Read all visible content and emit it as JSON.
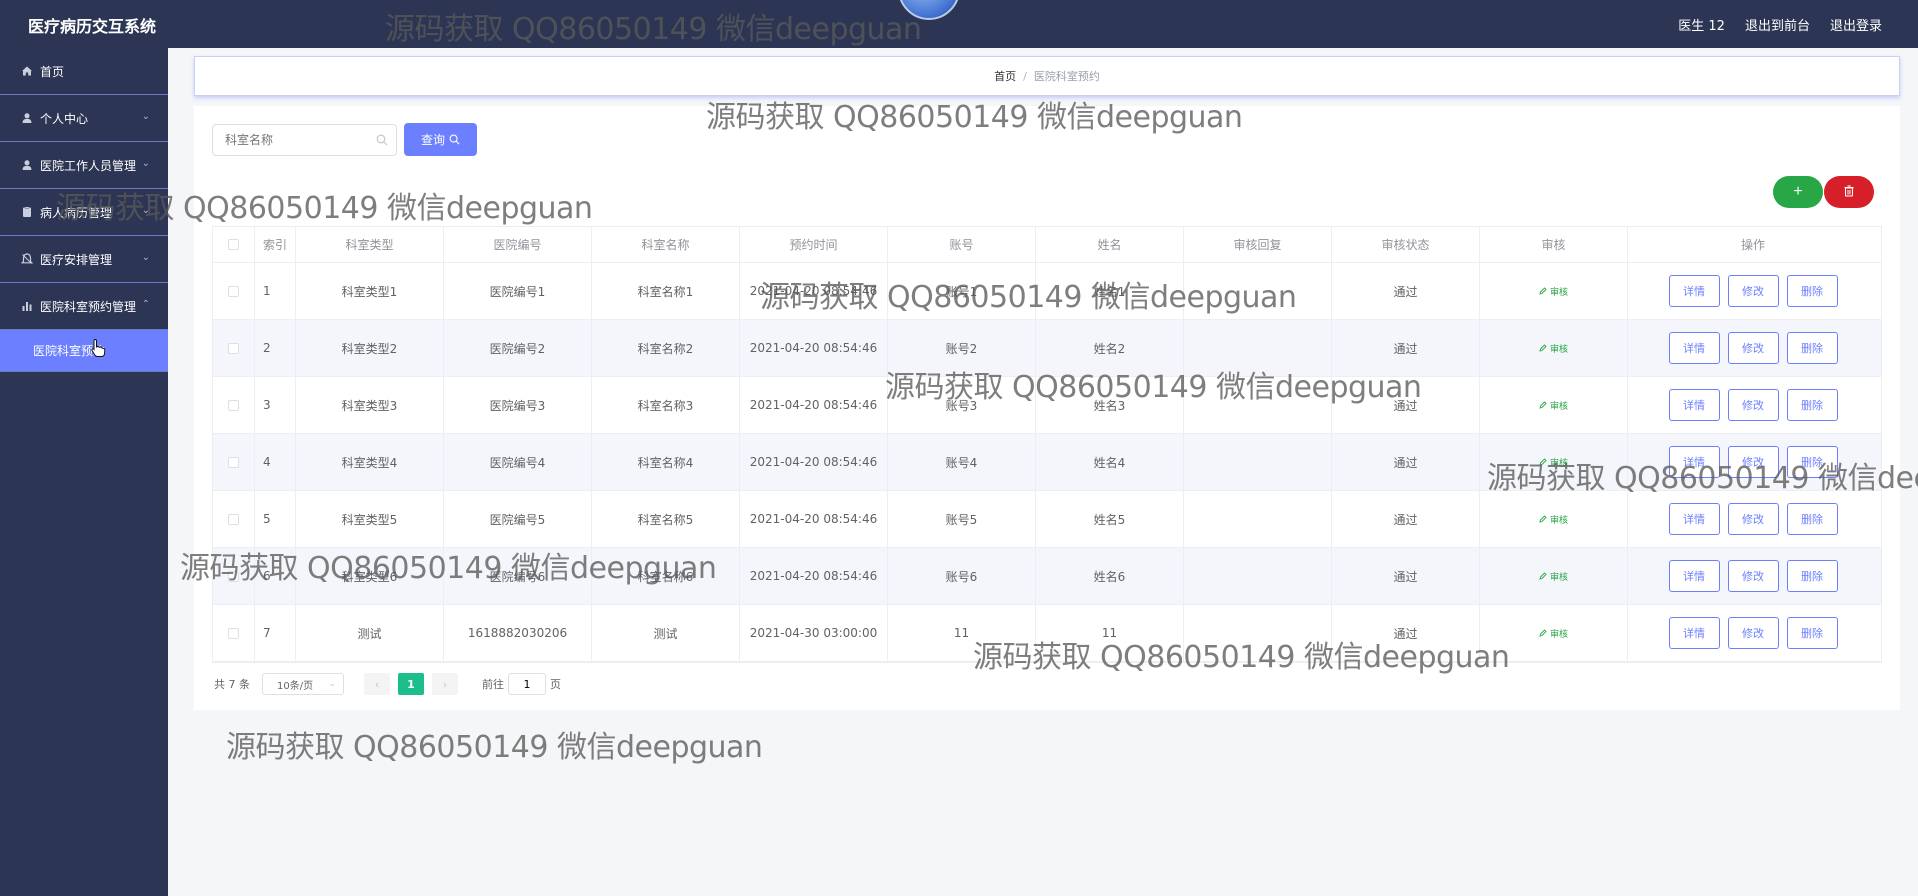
{
  "app": {
    "title": "医疗病历交互系统"
  },
  "top_actions": {
    "user": "医生 12",
    "to_front": "退出到前台",
    "logout": "退出登录"
  },
  "sidebar": {
    "items": [
      {
        "label": "首页"
      },
      {
        "label": "个人中心"
      },
      {
        "label": "医院工作人员管理"
      },
      {
        "label": "病人病历管理"
      },
      {
        "label": "医疗安排管理"
      },
      {
        "label": "医院科室预约管理"
      }
    ],
    "submenu": {
      "label": "医院科室预约"
    }
  },
  "breadcrumb": {
    "home": "首页",
    "separator": "/",
    "current": "医院科室预约"
  },
  "search": {
    "placeholder": "科室名称",
    "button_label": "查询"
  },
  "actions": {
    "add_label": "+",
    "delete_label": "🗑"
  },
  "table": {
    "headers": [
      "索引",
      "科室类型",
      "医院编号",
      "科室名称",
      "预约时间",
      "账号",
      "姓名",
      "审核回复",
      "审核状态",
      "审核",
      "操作"
    ],
    "audit_label": "审核",
    "op_labels": {
      "detail": "详情",
      "edit": "修改",
      "delete": "删除"
    },
    "rows": [
      {
        "idx": "1",
        "dept_type": "科室类型1",
        "hospital_no": "医院编号1",
        "dept_name": "科室名称1",
        "time": "2021-04-20 08:54:46",
        "account": "账号1",
        "name": "姓名1",
        "reply": "",
        "status": "通过"
      },
      {
        "idx": "2",
        "dept_type": "科室类型2",
        "hospital_no": "医院编号2",
        "dept_name": "科室名称2",
        "time": "2021-04-20 08:54:46",
        "account": "账号2",
        "name": "姓名2",
        "reply": "",
        "status": "通过"
      },
      {
        "idx": "3",
        "dept_type": "科室类型3",
        "hospital_no": "医院编号3",
        "dept_name": "科室名称3",
        "time": "2021-04-20 08:54:46",
        "account": "账号3",
        "name": "姓名3",
        "reply": "",
        "status": "通过"
      },
      {
        "idx": "4",
        "dept_type": "科室类型4",
        "hospital_no": "医院编号4",
        "dept_name": "科室名称4",
        "time": "2021-04-20 08:54:46",
        "account": "账号4",
        "name": "姓名4",
        "reply": "",
        "status": "通过"
      },
      {
        "idx": "5",
        "dept_type": "科室类型5",
        "hospital_no": "医院编号5",
        "dept_name": "科室名称5",
        "time": "2021-04-20 08:54:46",
        "account": "账号5",
        "name": "姓名5",
        "reply": "",
        "status": "通过"
      },
      {
        "idx": "6",
        "dept_type": "科室类型6",
        "hospital_no": "医院编号6",
        "dept_name": "科室名称6",
        "time": "2021-04-20 08:54:46",
        "account": "账号6",
        "name": "姓名6",
        "reply": "",
        "status": "通过"
      },
      {
        "idx": "7",
        "dept_type": "测试",
        "hospital_no": "1618882030206",
        "dept_name": "测试",
        "time": "2021-04-30 03:00:00",
        "account": "11",
        "name": "11",
        "reply": "",
        "status": "通过"
      }
    ]
  },
  "pagination": {
    "total": "共 7 条",
    "page_size": "10条/页",
    "current_page": "1",
    "goto_prefix": "前往",
    "goto_value": "1",
    "goto_suffix": "页"
  },
  "watermark": "源码获取 QQ86050149 微信deepguan",
  "colors": {
    "sidebar": "#2c3554",
    "accent": "#6c80ff",
    "add": "#27a745",
    "delete": "#d61f28",
    "page_active": "#1cbf8c"
  }
}
